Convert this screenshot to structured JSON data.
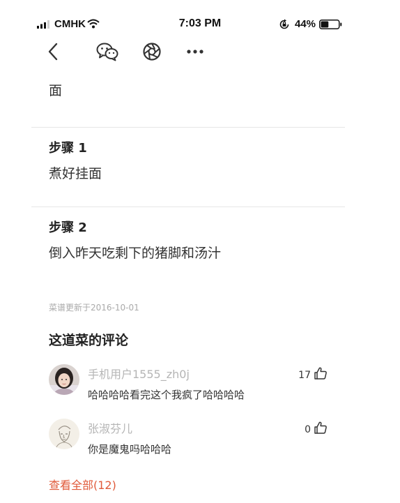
{
  "status_bar": {
    "carrier": "CMHK",
    "time": "7:03 PM",
    "battery_percent": "44%",
    "battery_level": 0.44,
    "icons": [
      "signal-icon",
      "wifi-icon",
      "orientation-lock-icon",
      "battery-icon"
    ]
  },
  "toolbar": {
    "icons": [
      "back-icon",
      "wechat-icon",
      "moments-icon",
      "more-icon"
    ]
  },
  "recipe": {
    "ingredient": "面",
    "steps": [
      {
        "title": "步骤 1",
        "text": "煮好挂面"
      },
      {
        "title": "步骤 2",
        "text": "倒入昨天吃剩下的猪脚和汤汁"
      }
    ],
    "updated": "菜谱更新于2016-10-01"
  },
  "comments": {
    "heading": "这道菜的评论",
    "items": [
      {
        "user": "手机用户1555_zh0j",
        "text": "哈哈哈哈看完这个我疯了哈哈哈哈",
        "likes": "17"
      },
      {
        "user": "张淑芬儿",
        "text": "你是魔鬼吗哈哈哈",
        "likes": "0"
      }
    ],
    "view_all": "查看全部(12)"
  },
  "colors": {
    "accent": "#e05a3a",
    "muted_text": "#b5b5b5",
    "divider": "#e6e6e6"
  }
}
